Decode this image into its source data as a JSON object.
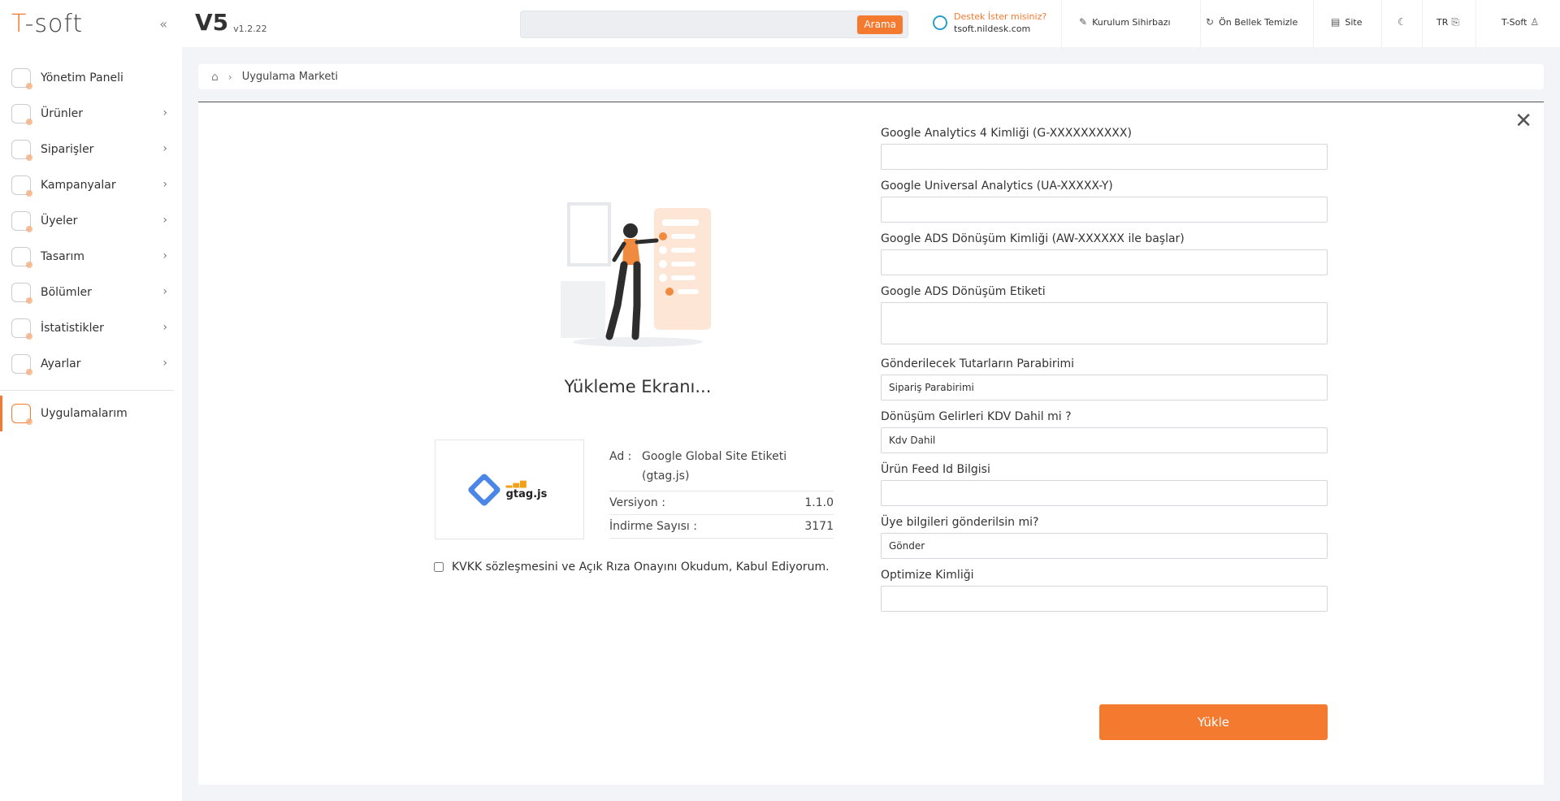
{
  "sidebar": {
    "logo": "T-soft",
    "collapse_glyph": "«",
    "items": [
      {
        "label": "Yönetim Paneli",
        "icon": "dashboard-icon"
      },
      {
        "label": "Ürünler",
        "icon": "products-icon"
      },
      {
        "label": "Siparişler",
        "icon": "orders-icon"
      },
      {
        "label": "Kampanyalar",
        "icon": "campaigns-icon"
      },
      {
        "label": "Üyeler",
        "icon": "members-icon"
      },
      {
        "label": "Tasarım",
        "icon": "design-icon"
      },
      {
        "label": "Bölümler",
        "icon": "sections-icon"
      },
      {
        "label": "İstatistikler",
        "icon": "statistics-icon"
      },
      {
        "label": "Ayarlar",
        "icon": "settings-icon"
      },
      {
        "label": "Uygulamalarım",
        "icon": "apps-icon"
      }
    ]
  },
  "header": {
    "brand": "V5",
    "version": "v1.2.22",
    "search_placeholder": "",
    "search_button": "Arama",
    "support_title": "Destek İster misiniz?",
    "support_link": "tsoft.nildesk.com",
    "setup_wizard": "Kurulum Sihirbazı",
    "clear_cache": "Ön Bellek Temizle",
    "site": "Site",
    "language": "TR",
    "user": "T-Soft"
  },
  "breadcrumb": {
    "current": "Uygulama Marketi"
  },
  "install": {
    "title": "Yükleme Ekranı...",
    "app_logo_text": "gtag.js",
    "name_key": "Ad :",
    "name_value": "Google Global Site Etiketi (gtag.js)",
    "version_key": "Versiyon :",
    "version_value": "1.1.0",
    "downloads_key": "İndirme Sayısı :",
    "downloads_value": "3171",
    "kvkk_text": "KVKK sözleşmesini ve Açık Rıza Onayını Okudum, Kabul Ediyorum.",
    "submit_label": "Yükle"
  },
  "form": {
    "fields": [
      {
        "label": "Google Analytics 4 Kimliği (G-XXXXXXXXXX)",
        "value": ""
      },
      {
        "label": "Google Universal Analytics (UA-XXXXX-Y)",
        "value": ""
      },
      {
        "label": "Google ADS Dönüşüm Kimliği (AW-XXXXXX ile başlar)",
        "value": ""
      },
      {
        "label": "Google ADS Dönüşüm Etiketi",
        "value": ""
      },
      {
        "label": "Gönderilecek Tutarların Parabirimi",
        "value": "Sipariş Parabirimi"
      },
      {
        "label": "Dönüşüm Gelirleri KDV Dahil mi ?",
        "value": "Kdv Dahil"
      },
      {
        "label": "Ürün Feed Id Bilgisi",
        "value": ""
      },
      {
        "label": "Üye bilgileri gönderilsin mi?",
        "value": "Gönder"
      },
      {
        "label": "Optimize Kimliği",
        "value": ""
      }
    ]
  },
  "colors": {
    "accent": "#f47a30",
    "background": "#f3f4f7"
  }
}
